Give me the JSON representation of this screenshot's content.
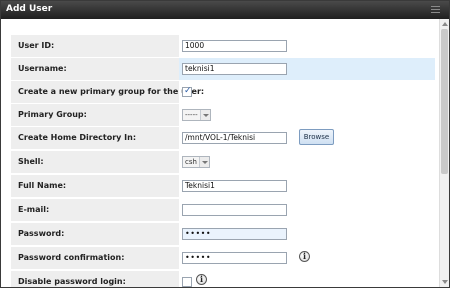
{
  "dialog": {
    "title": "Add User"
  },
  "form": {
    "user_id": {
      "label": "User ID:",
      "value": "1000"
    },
    "username": {
      "label": "Username:",
      "value": "teknisi1"
    },
    "create_group": {
      "label": "Create a new primary group for the user:",
      "checked": true
    },
    "primary_group": {
      "label": "Primary Group:",
      "value": "-----"
    },
    "home_dir": {
      "label": "Create Home Directory In:",
      "value": "/mnt/VOL-1/Teknisi",
      "browse_label": "Browse"
    },
    "shell": {
      "label": "Shell:",
      "value": "csh"
    },
    "full_name": {
      "label": "Full Name:",
      "value": "Teknisi1"
    },
    "email": {
      "label": "E-mail:",
      "value": ""
    },
    "password": {
      "label": "Password:",
      "value": "•••••"
    },
    "password_confirm": {
      "label": "Password confirmation:",
      "value": "•••••"
    },
    "disable_pw_login": {
      "label": "Disable password login:",
      "checked": false
    }
  },
  "icons": {
    "info": "info-icon",
    "close": "close-icon"
  },
  "colors": {
    "titlebar": "#2b2b2b",
    "highlight_row": "#deeefb",
    "label_bg": "#eeeeee"
  }
}
